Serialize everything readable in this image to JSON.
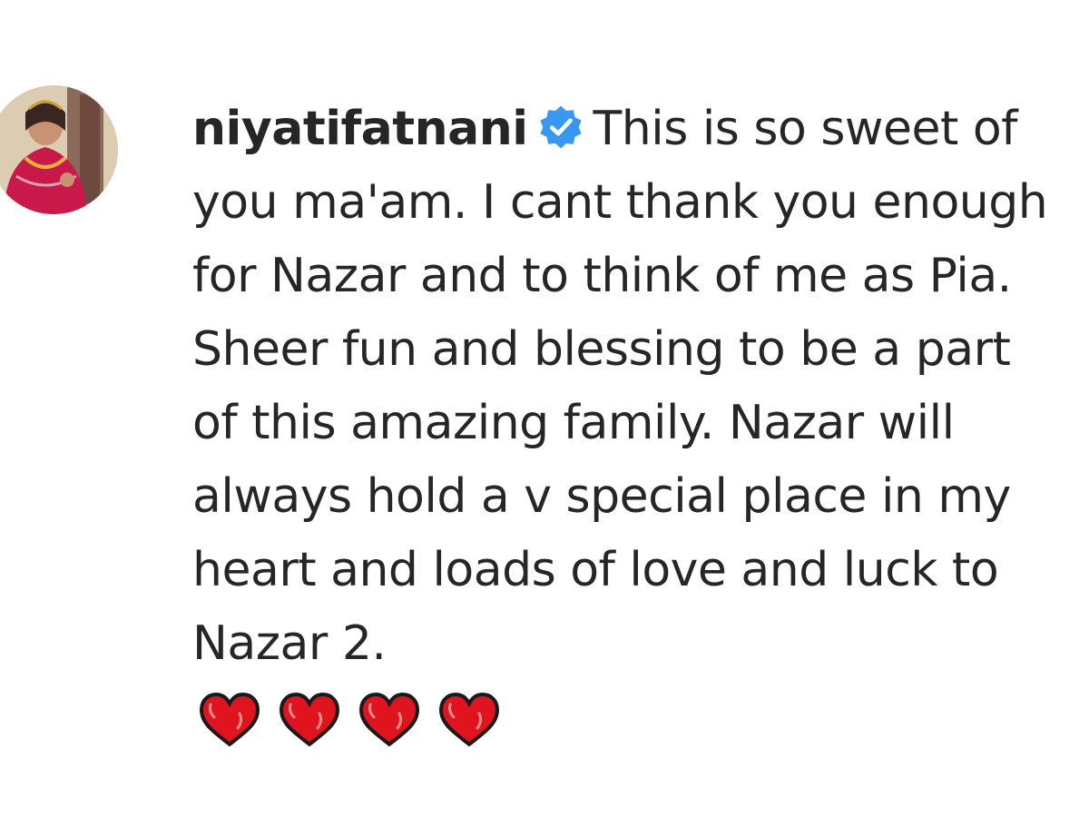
{
  "comment": {
    "username": "niyatifatnani",
    "verified_icon": "verified-badge-icon",
    "text": "This is so sweet of you ma'am. I cant thank you enough for Nazar and to think of me as Pia. Sheer fun and blessing to be a part of this amazing family. Nazar will always hold a v special place in my heart and loads of love and luck to Nazar 2.",
    "emoji": [
      "red-heart-icon",
      "red-heart-icon",
      "red-heart-icon",
      "red-heart-icon"
    ]
  },
  "colors": {
    "text": "#262626",
    "verified_blue": "#3897f0",
    "heart_red": "#e0141e"
  }
}
